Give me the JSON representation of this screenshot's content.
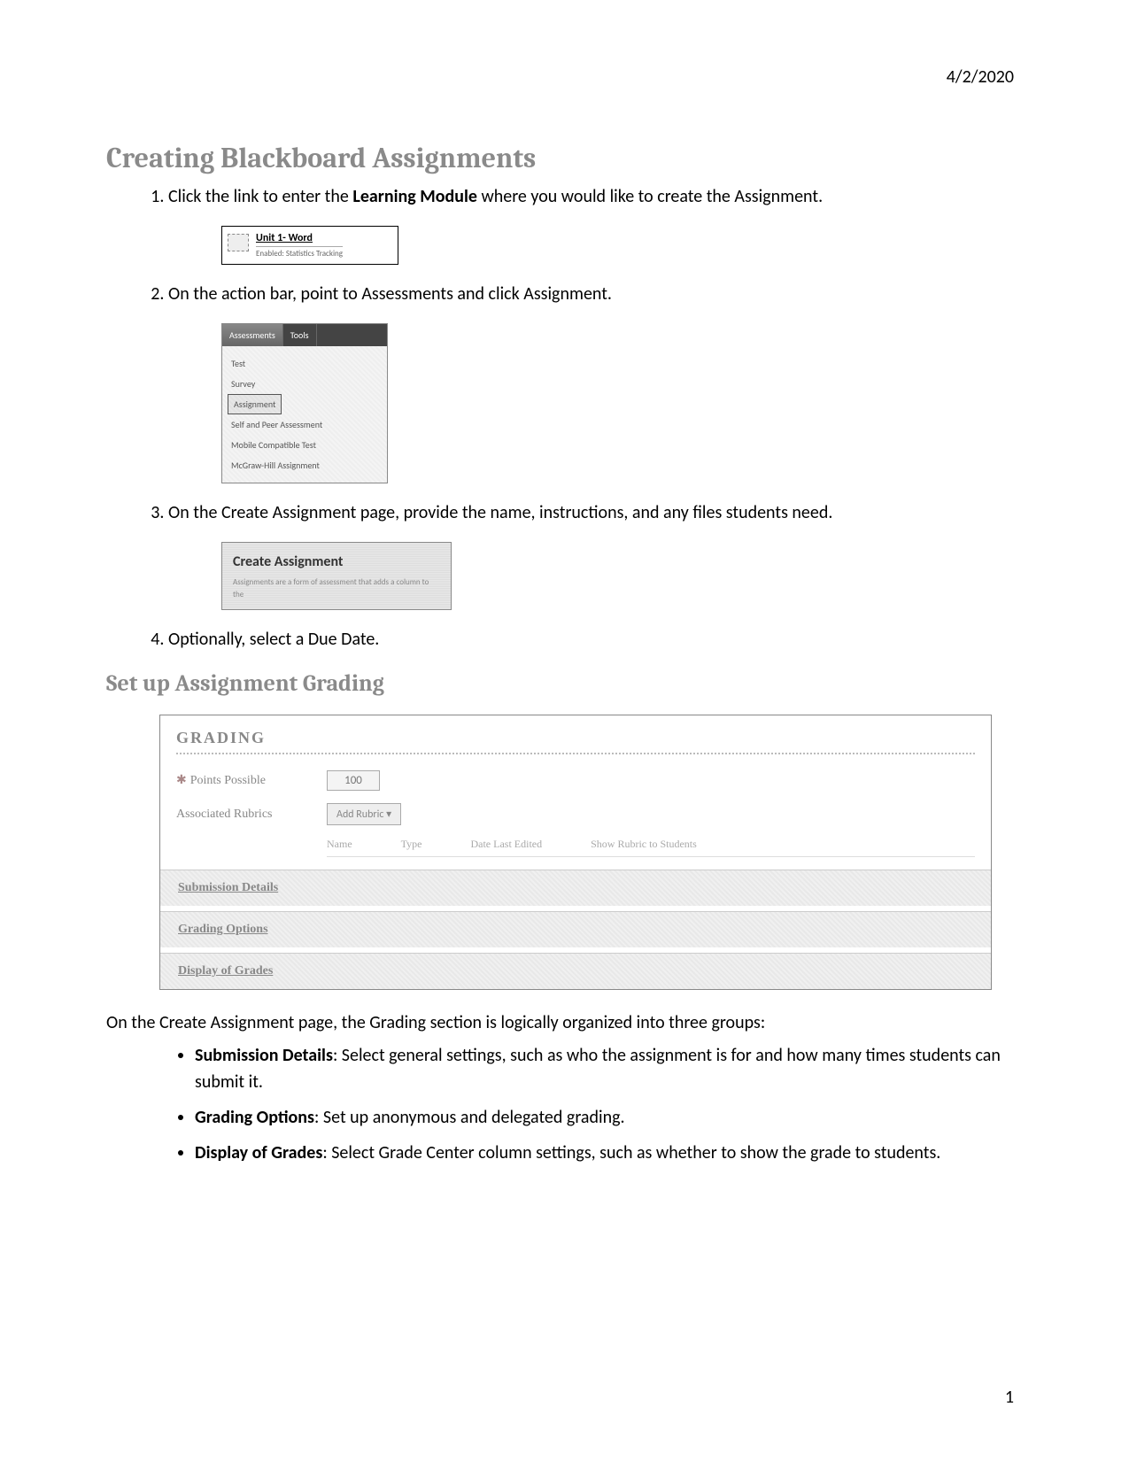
{
  "header": {
    "date": "4/2/2020"
  },
  "footer": {
    "page_number": "1"
  },
  "title": "Creating Blackboard Assignments",
  "steps": {
    "s1_pre": "Click the link to enter the ",
    "s1_bold": "Learning Module",
    "s1_post": " where you would like to create the Assignment.",
    "s2": "On the action bar, point to Assessments and click Assignment.",
    "s3": "On the Create Assignment page, provide the name, instructions, and any files students need.",
    "s4": "Optionally, select a Due Date."
  },
  "shot1": {
    "title": "Unit 1- Word",
    "sub": "Enabled: Statistics Tracking"
  },
  "shot2": {
    "tab1": "Assessments",
    "tab2": "Tools",
    "items": [
      "Test",
      "Survey",
      "Assignment",
      "Self and Peer Assessment",
      "Mobile Compatible Test",
      "McGraw-Hill Assignment"
    ]
  },
  "shot3": {
    "title": "Create Assignment",
    "sub": "Assignments are a form of assessment that adds a column to the"
  },
  "subheading": "Set up Assignment Grading",
  "grading": {
    "heading": "GRADING",
    "points_label": "Points Possible",
    "points_value": "100",
    "rubrics_label": "Associated Rubrics",
    "add_rubric": "Add Rubric ▾",
    "cols": [
      "Name",
      "Type",
      "Date Last Edited",
      "Show Rubric to Students"
    ],
    "acc1": "Submission Details",
    "acc2": "Grading Options",
    "acc3": "Display of Grades"
  },
  "body_para": "On the Create Assignment page, the Grading section is logically organized into three groups:",
  "bullets": {
    "b1_bold": "Submission Details",
    "b1_rest": ": Select general settings, such as who the assignment is for and how many times students can submit it.",
    "b2_bold": "Grading Options",
    "b2_rest": ": Set up anonymous and delegated grading.",
    "b3_bold": "Display of Grades",
    "b3_rest": ": Select Grade Center column settings, such as whether to show the grade to students."
  }
}
